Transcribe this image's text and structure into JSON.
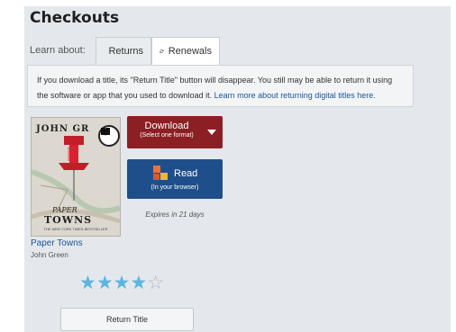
{
  "page": {
    "title": "Checkouts"
  },
  "learn": {
    "label": "Learn about:",
    "tabs": [
      {
        "label": "Returns",
        "icon": "return-arrow-icon",
        "active": false
      },
      {
        "label": "Renewals",
        "icon": "refresh-icon",
        "active": true
      }
    ]
  },
  "info": {
    "text": "If you download a title, its \"Return Title\" button will disappear. You still may be able to return it using the software or app that you used to download it.",
    "link": "Learn more about returning digital titles here."
  },
  "book": {
    "cover": {
      "author": "JOHN GR",
      "title_line1": "PAPER",
      "title_line2": "TOWNS",
      "tagline": "THE NEW YORK TIMES BESTSELLER",
      "badge_icon": "book-icon"
    },
    "title": "Paper Towns",
    "author": "John Green",
    "rating": 4,
    "rating_max": 5
  },
  "actions": {
    "download_label": "Download",
    "download_sub": "(Select one format)",
    "read_label": "Read",
    "read_sub": "(In your browser)",
    "expires": "Expires in 21 days",
    "return_label": "Return Title"
  },
  "colors": {
    "download_bg": "#8b1f24",
    "read_bg": "#1f4f8a",
    "star_full": "#5bb5e0",
    "link": "#1a5599"
  }
}
